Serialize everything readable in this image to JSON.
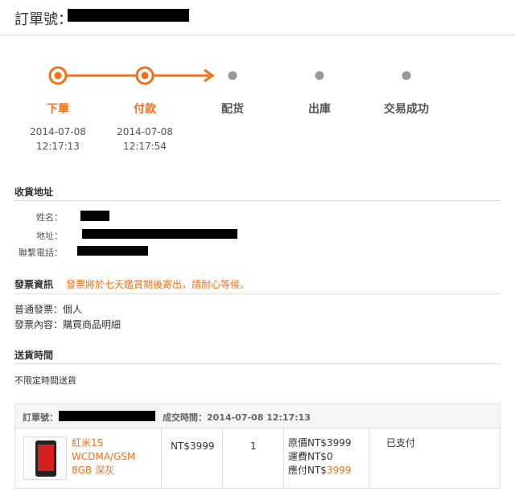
{
  "order": {
    "number_label": "訂單號："
  },
  "progress": {
    "steps": [
      {
        "name": "下單",
        "date": "2014-07-08",
        "time": "12:17:13",
        "done": true
      },
      {
        "name": "付款",
        "date": "2014-07-08",
        "time": "12:17:54",
        "done": true
      },
      {
        "name": "配货",
        "date": "",
        "time": "",
        "done": false
      },
      {
        "name": "出庫",
        "date": "",
        "time": "",
        "done": false
      },
      {
        "name": "交易成功",
        "date": "",
        "time": "",
        "done": false
      }
    ]
  },
  "shipping_address": {
    "title": "收貨地址",
    "name_label": "姓名：",
    "address_label": "地址：",
    "phone_label": "聯繫電話："
  },
  "invoice": {
    "title": "發票資訊",
    "notice": "發票將於七天鑑賞期後寄出，請耐心等候。",
    "type_line": "普通發票：個人",
    "content_line": "發票內容：購買商品明細"
  },
  "delivery": {
    "title": "送貨時間",
    "value": "不限定時間送貨"
  },
  "order_table": {
    "order_no_label": "訂單號：",
    "deal_time_label": "成交時間：2014-07-08 12:17:13",
    "product_name": [
      "紅米1S",
      "WCDMA/GSM",
      "8GB 深灰"
    ],
    "unit_price": "NT$3999",
    "quantity": "1",
    "original_price": "原價NT$3999",
    "shipping_fee": "運費NT$0",
    "payable_label": "應付NT$",
    "payable_amount": "3999",
    "status": "已支付"
  },
  "colors": {
    "accent": "#f0711a",
    "pending": "#999999"
  }
}
